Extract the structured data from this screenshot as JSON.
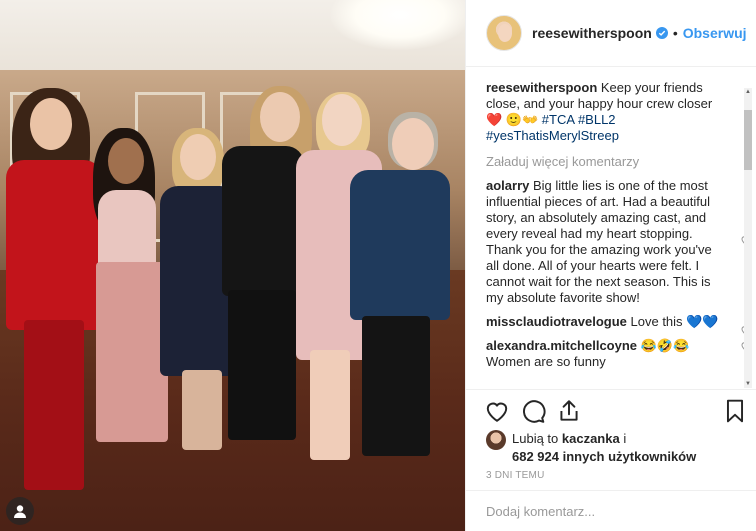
{
  "post": {
    "username": "reesewitherspoon",
    "follow_label": "Obserwuj",
    "caption_text": "Keep your friends close, and your happy hour crew closer ❤️ 🙂👐 ",
    "hashtags": [
      "#TCA",
      "#BLL2",
      "#yesThatisMerylStreep"
    ],
    "load_more_label": "Załaduj więcej komentarzy"
  },
  "comments": [
    {
      "user": "aolarry",
      "text": "Big little lies is one of the most influential pieces of art. Had a beautiful story, an absolutely amazing cast, and every reveal had my heart stopping. Thank you for the amazing work you've all done. All of your hearts were felt. I cannot wait for the next season. This is my absolute favorite show!"
    },
    {
      "user": "missclaudiotravelogue",
      "text": "Love this 💙💙"
    },
    {
      "user": "alexandra.mitchellcoyne",
      "text": "😂🤣😂 Women are so funny"
    }
  ],
  "likes": {
    "line1_prefix": "Lubią to",
    "liker": "kaczanka",
    "line1_suffix": "i",
    "line2": "682 924 innych użytkowników"
  },
  "timestamp": "3 DNI TEMU",
  "add_comment_placeholder": "Dodaj komentarz...",
  "icons": {
    "like": "heart-icon",
    "comment": "comment-icon",
    "share": "share-icon",
    "save": "bookmark-icon",
    "verified": "verified-badge-icon",
    "user_tag": "user-tag-icon"
  },
  "colors": {
    "link_blue": "#3897f0",
    "hashtag": "#003569",
    "muted": "#999999",
    "heart_red": "#c0392b"
  }
}
